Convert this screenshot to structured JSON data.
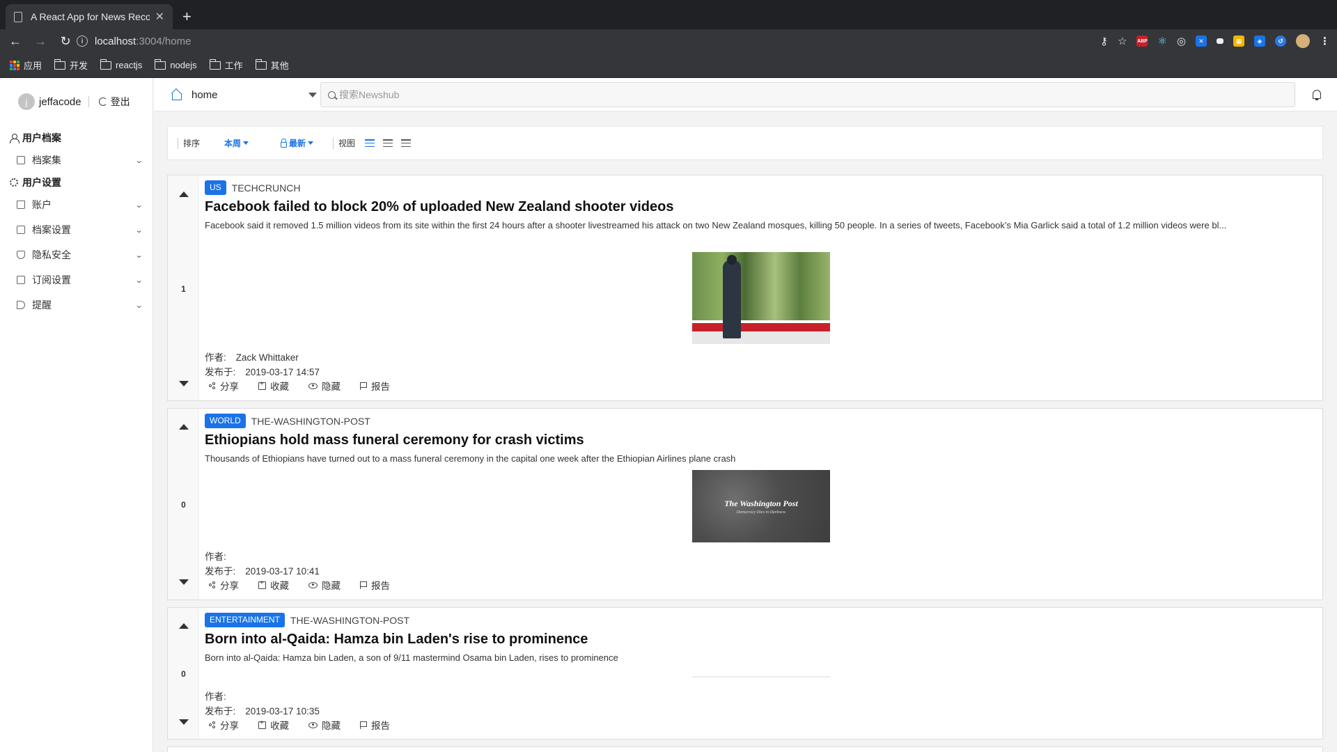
{
  "browser": {
    "tab_title": "A React App for News Recomm",
    "url_host": "localhost",
    "url_path": ":3004/home",
    "bookmarks": [
      {
        "label": "应用",
        "icon": "apps-icon"
      },
      {
        "label": "开发",
        "icon": "folder-icon"
      },
      {
        "label": "reactjs",
        "icon": "folder-icon"
      },
      {
        "label": "nodejs",
        "icon": "folder-icon"
      },
      {
        "label": "工作",
        "icon": "folder-icon"
      },
      {
        "label": "其他",
        "icon": "folder-icon"
      }
    ],
    "extensions": [
      "key-icon",
      "star-icon",
      "adblock-icon",
      "react-devtools-icon",
      "target-icon",
      "translate-icon",
      "flag-icon",
      "calendar-icon",
      "dropbox-icon",
      "sync-icon",
      "profile-avatar",
      "menu-dots-icon"
    ],
    "extension_labels": {
      "adblock": "ABP"
    }
  },
  "user": {
    "avatar_initial": "j",
    "name": "jeffacode",
    "logout_label": "登出"
  },
  "sidebar": {
    "profile_section": "用户档案",
    "profile_items": [
      {
        "label": "档案集",
        "icon": "folder-icon"
      }
    ],
    "settings_section": "用户设置",
    "settings_items": [
      {
        "label": "账户",
        "icon": "account-icon"
      },
      {
        "label": "档案设置",
        "icon": "profile-settings-icon"
      },
      {
        "label": "隐私安全",
        "icon": "shield-icon"
      },
      {
        "label": "订阅设置",
        "icon": "lock-icon"
      },
      {
        "label": "提醒",
        "icon": "megaphone-icon"
      }
    ]
  },
  "topbar": {
    "location": "home",
    "search_placeholder": "搜索Newshub"
  },
  "sortbar": {
    "sort_label": "排序",
    "period": "本周",
    "order": "最新",
    "view_label": "视图"
  },
  "articles": [
    {
      "category": "US",
      "source": "TECHCRUNCH",
      "title": "Facebook failed to block 20% of uploaded New Zealand shooter videos",
      "summary": "Facebook said it removed 1.5 million videos from its site within the first 24 hours after a shooter livestreamed his attack on two New Zealand mosques, killing 50 people. In a series of tweets, Facebook’s Mia Garlick said a total of 1.2 million videos were bl...",
      "score": "1",
      "author_label": "作者:",
      "author": "Zack Whittaker",
      "published_label": "发布于:",
      "published": "2019-03-17 14:57"
    },
    {
      "category": "WORLD",
      "source": "THE-WASHINGTON-POST",
      "title": "Ethiopians hold mass funeral ceremony for crash victims",
      "summary": "Thousands of Ethiopians have turned out to a mass funeral ceremony in the capital one week after the Ethiopian Airlines plane crash",
      "score": "0",
      "author_label": "作者:",
      "author": "",
      "published_label": "发布于:",
      "published": "2019-03-17 10:41",
      "image_title": "The Washington Post",
      "image_tagline": "Democracy Dies in Darkness"
    },
    {
      "category": "ENTERTAINMENT",
      "source": "THE-WASHINGTON-POST",
      "title": "Born into al-Qaida: Hamza bin Laden's rise to prominence",
      "summary": "Born into al-Qaida: Hamza bin Laden, a son of 9/11 mastermind Osama bin Laden, rises to prominence",
      "score": "0",
      "author_label": "作者:",
      "author": "",
      "published_label": "发布于:",
      "published": "2019-03-17 10:35"
    }
  ],
  "actions": {
    "share": "分享",
    "save": "收藏",
    "hide": "隐藏",
    "report": "报告"
  },
  "colors": {
    "accent": "#1a73e8",
    "chrome_dark": "#202124",
    "chrome_toolbar": "#35363a"
  }
}
